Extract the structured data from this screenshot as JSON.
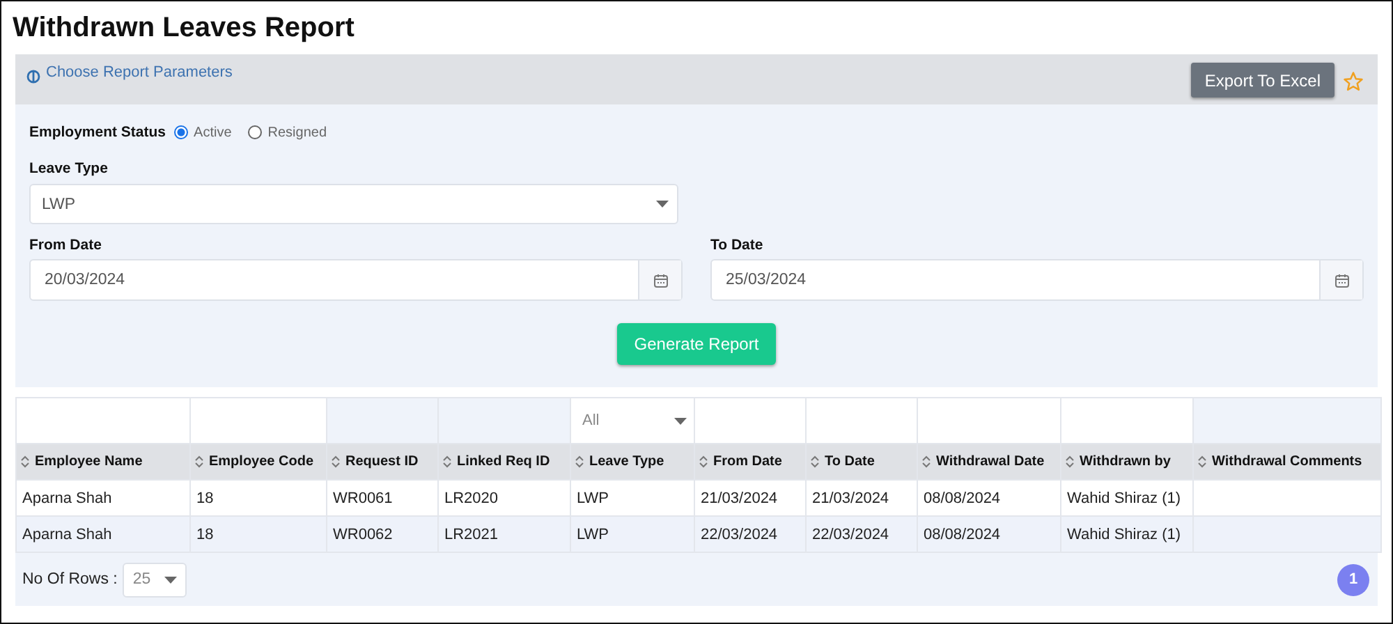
{
  "page_title": "Withdrawn Leaves Report",
  "parameters": {
    "header": "Choose Report Parameters",
    "export_button": "Export To Excel",
    "favorite": {
      "on": false
    },
    "employment_status": {
      "label": "Employment Status",
      "options": [
        {
          "label": "Active",
          "selected": true
        },
        {
          "label": "Resigned",
          "selected": false
        }
      ]
    },
    "leave_type": {
      "label": "Leave Type",
      "value": "LWP"
    },
    "from_date": {
      "label": "From Date",
      "value": "20/03/2024"
    },
    "to_date": {
      "label": "To Date",
      "value": "25/03/2024"
    },
    "generate_button": "Generate Report"
  },
  "table": {
    "columns": [
      {
        "label": "Employee Name",
        "filter": {
          "kind": "text"
        }
      },
      {
        "label": "Employee Code",
        "filter": {
          "kind": "text"
        }
      },
      {
        "label": "Request ID",
        "filter": {
          "kind": "none"
        }
      },
      {
        "label": "Linked Req ID",
        "filter": {
          "kind": "none"
        }
      },
      {
        "label": "Leave Type",
        "filter": {
          "kind": "select",
          "value": "All"
        }
      },
      {
        "label": "From Date",
        "filter": {
          "kind": "text"
        }
      },
      {
        "label": "To Date",
        "filter": {
          "kind": "text"
        }
      },
      {
        "label": "Withdrawal Date",
        "filter": {
          "kind": "text"
        }
      },
      {
        "label": "Withdrawn by",
        "filter": {
          "kind": "text"
        }
      },
      {
        "label": "Withdrawal Comments",
        "filter": {
          "kind": "none"
        }
      }
    ],
    "rows": [
      [
        "Aparna Shah",
        "18",
        "WR0061",
        "LR2020",
        "LWP",
        "21/03/2024",
        "21/03/2024",
        "08/08/2024",
        "Wahid Shiraz (1)",
        ""
      ],
      [
        "Aparna Shah",
        "18",
        "WR0062",
        "LR2021",
        "LWP",
        "22/03/2024",
        "22/03/2024",
        "08/08/2024",
        "Wahid Shiraz (1)",
        ""
      ]
    ]
  },
  "footer": {
    "rows_label": "No Of Rows :",
    "rows_value": "25",
    "pages": [
      {
        "label": "1",
        "selected": true
      }
    ]
  }
}
